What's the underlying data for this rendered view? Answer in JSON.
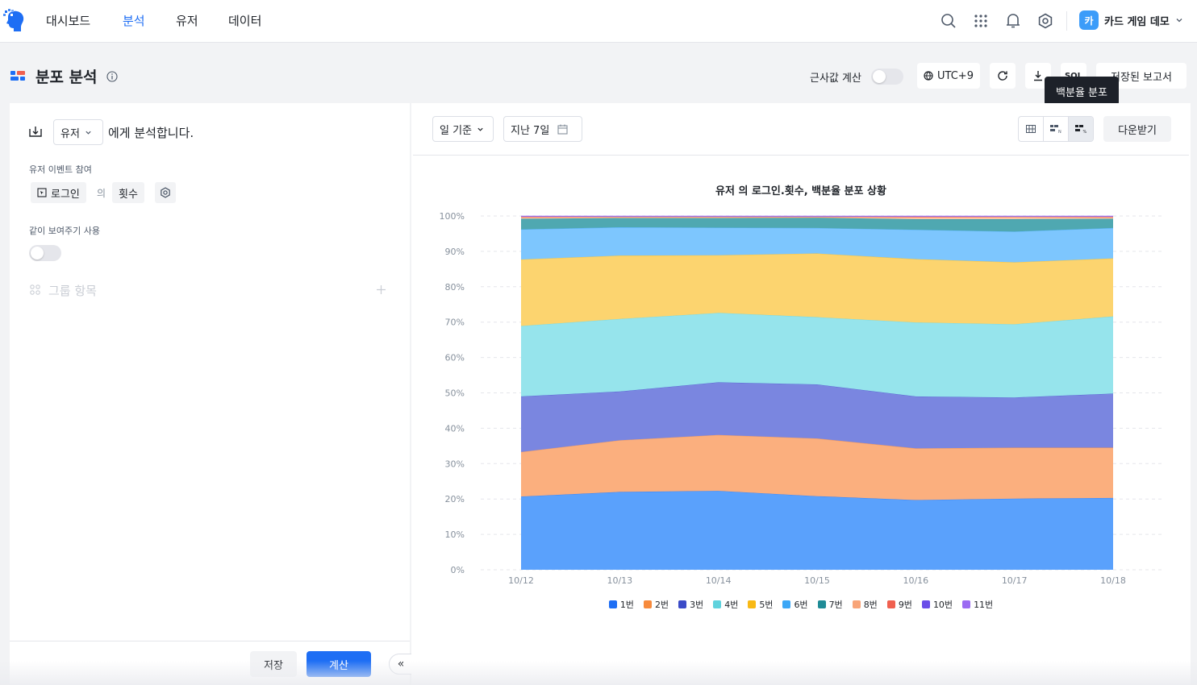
{
  "nav": {
    "items": [
      {
        "label": "대시보드",
        "active": false
      },
      {
        "label": "분석",
        "active": true
      },
      {
        "label": "유저",
        "active": false
      },
      {
        "label": "데이터",
        "active": false
      }
    ],
    "org_avatar": "카",
    "org_name": "카드 게임 데모",
    "icons": [
      "search-icon",
      "apps-grid-icon",
      "bell-icon",
      "gear-icon"
    ]
  },
  "header": {
    "title": "분포 분석",
    "approx_label": "근사값 계산",
    "timezone": "UTC+9",
    "sql_label": "SQL",
    "saved_reports": "저장된 보고서",
    "tooltip": "백분율 분포"
  },
  "left": {
    "subject_select": "유저",
    "subject_suffix": "에게 분석합니다.",
    "event_section_label": "유저 이벤트 참여",
    "event_name": "로그인",
    "event_of": "의",
    "event_metric": "횟수",
    "period_label": "같이 보여주기 사용",
    "group_label": "그룹 항목",
    "save_label": "저장",
    "calc_label": "계산",
    "collapse_label": "«"
  },
  "right": {
    "granularity": "일 기준",
    "date_range": "지난 7일",
    "download_label": "다운받기"
  },
  "chart_data": {
    "type": "area",
    "stacked": "percent",
    "title": "유저 의 로그인.횟수,  백분율 분포 상황",
    "categories": [
      "10/12",
      "10/13",
      "10/14",
      "10/15",
      "10/16",
      "10/17",
      "10/18"
    ],
    "y_ticks": [
      "0%",
      "10%",
      "20%",
      "30%",
      "40%",
      "50%",
      "60%",
      "70%",
      "80%",
      "90%",
      "100%"
    ],
    "ylim": [
      0,
      100
    ],
    "grid": "horizontal-dashed",
    "legend_position": "bottom",
    "series": [
      {
        "name": "1번",
        "color": "#5aa1fc",
        "values": [
          20.7,
          22.0,
          22.3,
          20.8,
          19.7,
          20.1,
          20.3
        ]
      },
      {
        "name": "2번",
        "color": "#fbaf7e",
        "values": [
          12.6,
          14.6,
          15.8,
          16.3,
          14.6,
          14.4,
          14.2
        ]
      },
      {
        "name": "3번",
        "color": "#7a86e0",
        "values": [
          15.7,
          13.8,
          14.9,
          15.3,
          14.7,
          14.2,
          15.3
        ]
      },
      {
        "name": "4번",
        "color": "#96e4ec",
        "values": [
          19.9,
          20.5,
          19.6,
          19.0,
          20.9,
          20.7,
          21.8
        ]
      },
      {
        "name": "5번",
        "color": "#fcd46f",
        "values": [
          18.8,
          17.9,
          16.3,
          18.0,
          17.9,
          17.5,
          16.4
        ]
      },
      {
        "name": "6번",
        "color": "#7dc6fe",
        "values": [
          8.5,
          8.0,
          7.8,
          7.2,
          8.3,
          8.7,
          8.6
        ]
      },
      {
        "name": "7번",
        "color": "#4fa8b1",
        "values": [
          3.0,
          2.6,
          2.7,
          2.9,
          3.0,
          3.5,
          2.6
        ]
      },
      {
        "name": "8번",
        "color": "#fbc4a3",
        "values": [
          0.4,
          0.3,
          0.3,
          0.2,
          0.5,
          0.6,
          0.4
        ]
      },
      {
        "name": "9번",
        "color": "#f67566",
        "values": [
          0.2,
          0.1,
          0.1,
          0.1,
          0.2,
          0.1,
          0.2
        ]
      },
      {
        "name": "10번",
        "color": "#9c8cf2",
        "values": [
          0.1,
          0.1,
          0.1,
          0.1,
          0.1,
          0.1,
          0.1
        ]
      },
      {
        "name": "11번",
        "color": "#b98ef5",
        "values": [
          0.1,
          0.1,
          0.1,
          0.1,
          0.1,
          0.1,
          0.1
        ]
      }
    ],
    "legend_colors": [
      "#1e6ef4",
      "#f78a3c",
      "#3b4bc7",
      "#5fd2dd",
      "#f8b915",
      "#3ca7f6",
      "#1f8b96",
      "#f8a478",
      "#f0604f",
      "#6a4de8",
      "#9b6bf2"
    ]
  }
}
